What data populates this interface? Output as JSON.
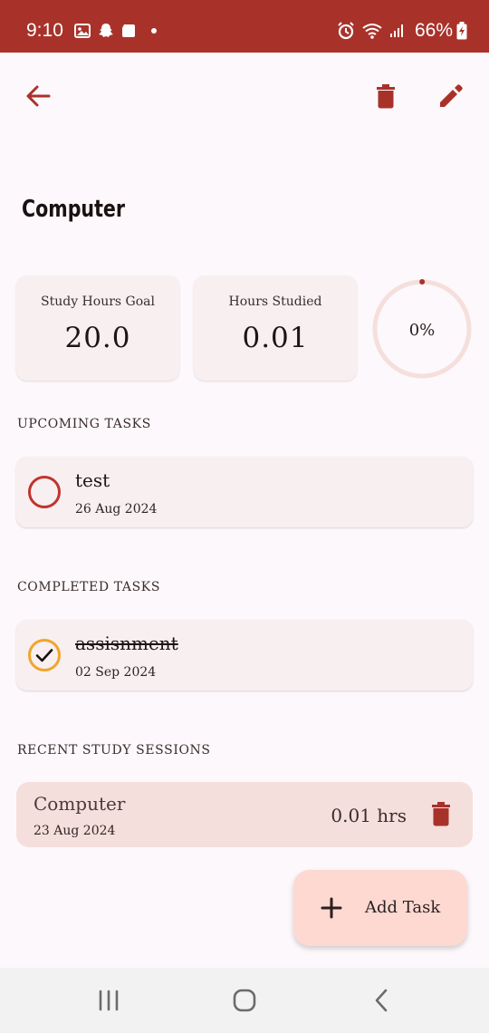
{
  "status_bar": {
    "time": "9:10",
    "battery": "66%",
    "left_icons": [
      "gallery-icon",
      "snapchat-icon",
      "notification-icon",
      "dot-icon"
    ],
    "right_icons": [
      "alarm-icon",
      "wifi-icon",
      "signal-icon"
    ]
  },
  "toolbar": {
    "back_icon": "arrow-back-icon",
    "delete_icon": "trash-icon",
    "edit_icon": "pencil-icon"
  },
  "subject": {
    "title": "Computer"
  },
  "stats": {
    "goal_label": "Study Hours Goal",
    "goal_value": "20.0",
    "studied_label": "Hours Studied",
    "studied_value": "0.01",
    "progress_text": "0%",
    "progress_fraction": 0.0005
  },
  "upcoming": {
    "section_title": "UPCOMING TASKS",
    "tasks": [
      {
        "title": "test",
        "date": "26 Aug 2024",
        "completed": false
      }
    ]
  },
  "completed": {
    "section_title": "COMPLETED TASKS",
    "tasks": [
      {
        "title": "assisnment",
        "date": "02 Sep 2024",
        "completed": true
      }
    ]
  },
  "sessions": {
    "section_title": "RECENT STUDY SESSIONS",
    "items": [
      {
        "subject": "Computer",
        "date": "23 Aug 2024",
        "duration": "0.01 hrs"
      }
    ]
  },
  "fab": {
    "label": "Add Task"
  },
  "colors": {
    "status_bar": "#a8322a",
    "accent": "#a8322a",
    "pending_ring": "#c0342c",
    "completed_ring": "#f0a52a",
    "card": "#f8eff0",
    "session_card": "#f5dfdc",
    "fab": "#fdd9d2"
  },
  "nav_bar": {
    "icons": [
      "recents-icon",
      "home-icon",
      "back-nav-icon"
    ]
  }
}
